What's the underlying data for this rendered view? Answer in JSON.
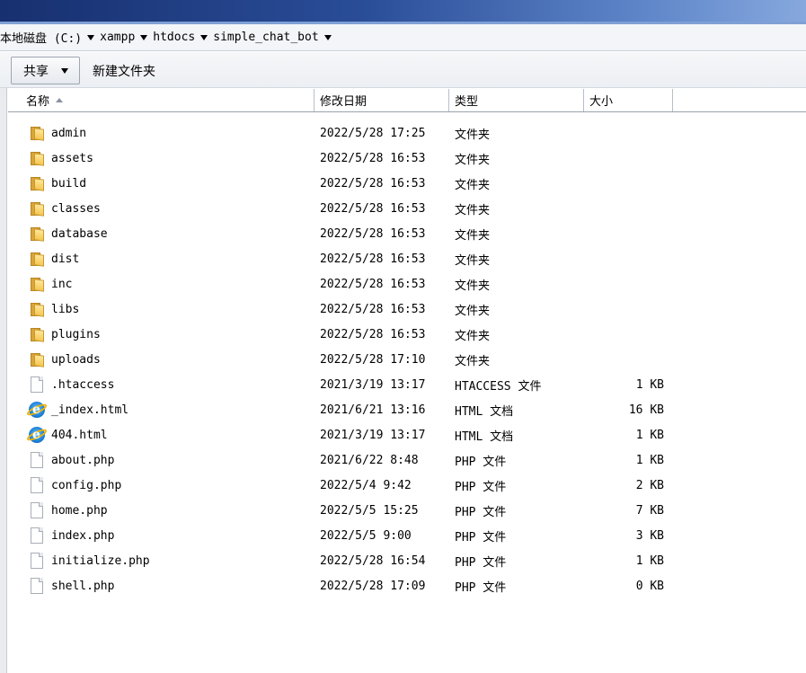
{
  "address": {
    "crumbs": [
      "本地磁盘 (C:)",
      "xampp",
      "htdocs",
      "simple_chat_bot"
    ]
  },
  "toolbar": {
    "share_label": "共享",
    "new_folder_label": "新建文件夹"
  },
  "columns": {
    "name": "名称",
    "date": "修改日期",
    "type": "类型",
    "size": "大小"
  },
  "files": [
    {
      "icon": "folder-icon",
      "name": "admin",
      "date": "2022/5/28 17:25",
      "type": "文件夹",
      "size": ""
    },
    {
      "icon": "folder-icon",
      "name": "assets",
      "date": "2022/5/28 16:53",
      "type": "文件夹",
      "size": ""
    },
    {
      "icon": "folder-icon",
      "name": "build",
      "date": "2022/5/28 16:53",
      "type": "文件夹",
      "size": ""
    },
    {
      "icon": "folder-icon",
      "name": "classes",
      "date": "2022/5/28 16:53",
      "type": "文件夹",
      "size": ""
    },
    {
      "icon": "folder-icon",
      "name": "database",
      "date": "2022/5/28 16:53",
      "type": "文件夹",
      "size": ""
    },
    {
      "icon": "folder-icon",
      "name": "dist",
      "date": "2022/5/28 16:53",
      "type": "文件夹",
      "size": ""
    },
    {
      "icon": "folder-icon",
      "name": "inc",
      "date": "2022/5/28 16:53",
      "type": "文件夹",
      "size": ""
    },
    {
      "icon": "folder-icon",
      "name": "libs",
      "date": "2022/5/28 16:53",
      "type": "文件夹",
      "size": ""
    },
    {
      "icon": "folder-icon",
      "name": "plugins",
      "date": "2022/5/28 16:53",
      "type": "文件夹",
      "size": ""
    },
    {
      "icon": "folder-icon",
      "name": "uploads",
      "date": "2022/5/28 17:10",
      "type": "文件夹",
      "size": ""
    },
    {
      "icon": "file-icon",
      "name": ".htaccess",
      "date": "2021/3/19 13:17",
      "type": "HTACCESS 文件",
      "size": "1 KB"
    },
    {
      "icon": "ie-html-icon",
      "name": "_index.html",
      "date": "2021/6/21 13:16",
      "type": "HTML 文档",
      "size": "16 KB"
    },
    {
      "icon": "ie-html-icon",
      "name": "404.html",
      "date": "2021/3/19 13:17",
      "type": "HTML 文档",
      "size": "1 KB"
    },
    {
      "icon": "file-icon",
      "name": "about.php",
      "date": "2021/6/22 8:48",
      "type": "PHP 文件",
      "size": "1 KB"
    },
    {
      "icon": "file-icon",
      "name": "config.php",
      "date": "2022/5/4 9:42",
      "type": "PHP 文件",
      "size": "2 KB"
    },
    {
      "icon": "file-icon",
      "name": "home.php",
      "date": "2022/5/5 15:25",
      "type": "PHP 文件",
      "size": "7 KB"
    },
    {
      "icon": "file-icon",
      "name": "index.php",
      "date": "2022/5/5 9:00",
      "type": "PHP 文件",
      "size": "3 KB"
    },
    {
      "icon": "file-icon",
      "name": "initialize.php",
      "date": "2022/5/28 16:54",
      "type": "PHP 文件",
      "size": "1 KB"
    },
    {
      "icon": "file-icon",
      "name": "shell.php",
      "date": "2022/5/28 17:09",
      "type": "PHP 文件",
      "size": "0 KB"
    }
  ]
}
